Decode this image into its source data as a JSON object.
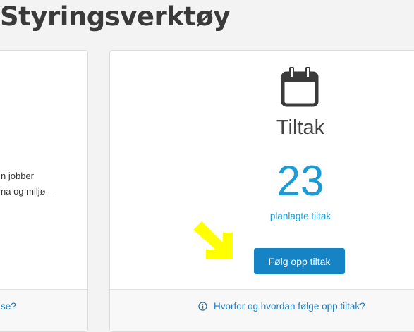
{
  "header": {
    "title": "Styringsverktøy"
  },
  "left_card": {
    "body_lines": [
      "n jobber",
      "na og miljø –"
    ],
    "footer_link": "se?"
  },
  "right_card": {
    "icon": "calendar-icon",
    "heading": "Tiltak",
    "count": "23",
    "count_label": "planlagte tiltak",
    "button_label": "Følg opp tiltak",
    "footer_icon": "info-icon",
    "footer_link": "Hvorfor og hvordan følge opp tiltak?"
  },
  "annotation": {
    "arrow_color": "#ffff00"
  },
  "colors": {
    "accent": "#1a9bd6",
    "button": "#1583c4",
    "link": "#1f7dbf",
    "background": "#f3f3f3"
  }
}
